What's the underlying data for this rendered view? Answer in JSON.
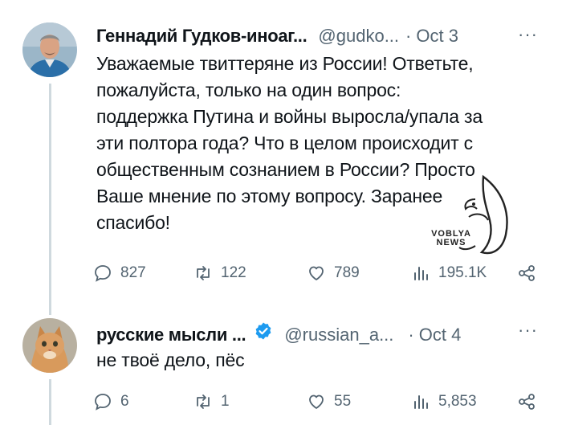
{
  "tweets": [
    {
      "name": "Геннадий Гудков-иноаг...",
      "handle": "@gudko...",
      "dot": "·",
      "date": "Oct 3",
      "more": "···",
      "text_lines": [
        "Уважаемые твиттеряне из России! Ответьте,",
        "пожалуйста, только на один вопрос:",
        "поддержка Путина и войны выросла/упала за",
        "эти полтора года? Что в целом происходит с",
        "общественным сознанием в России? Просто",
        "Ваше мнение по этому вопросу. Заранее",
        "спасибо!"
      ],
      "replies": "827",
      "retweets": "122",
      "likes": "789",
      "views": "195.1K",
      "avatar_icon": "person-photo-icon"
    },
    {
      "name": "русские мысли ...",
      "handle": "@russian_a...",
      "dot": "·",
      "date": "Oct 4",
      "more": "···",
      "verified": true,
      "text_lines": [
        "не твоё дело, пёс"
      ],
      "replies": "6",
      "retweets": "1",
      "likes": "55",
      "views": "5,853",
      "avatar_icon": "cat-photo-icon"
    }
  ],
  "watermark": {
    "line1": "VOBLYA",
    "line2": "NEWS"
  },
  "colors": {
    "text": "#0f1419",
    "secondary": "#536471",
    "thread_line": "#cfd9de",
    "verified": "#1d9bf0"
  }
}
